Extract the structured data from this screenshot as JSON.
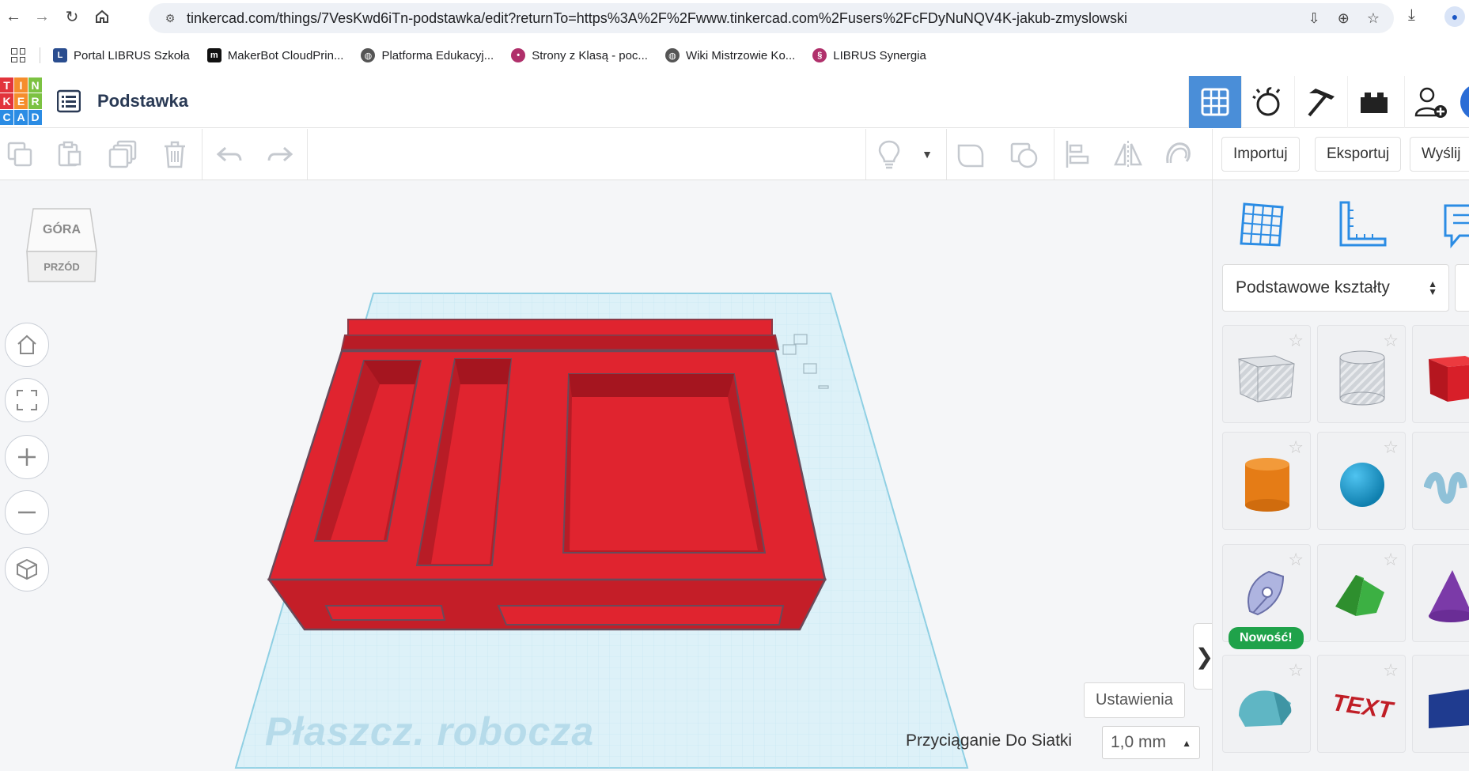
{
  "browser": {
    "url": "tinkercad.com/things/7VesKwd6iTn-podstawka/edit?returnTo=https%3A%2F%2Fwww.tinkercad.com%2Fusers%2FcFDyNuNQV4K-jakub-zmyslowski",
    "bookmarks": [
      {
        "label": "Portal LIBRUS Szkoła",
        "icon": "librus-icon",
        "color": "#2a4d8f"
      },
      {
        "label": "MakerBot CloudPrin...",
        "icon": "makerbot-icon",
        "color": "#111111"
      },
      {
        "label": "Platforma Edukacyj...",
        "icon": "globe-icon",
        "color": "#555555"
      },
      {
        "label": "Strony z Klasą - poc...",
        "icon": "klasa-icon",
        "color": "#b0306b"
      },
      {
        "label": "Wiki Mistrzowie Ko...",
        "icon": "globe-icon",
        "color": "#555555"
      },
      {
        "label": "LIBRUS Synergia",
        "icon": "synergia-icon",
        "color": "#b0306b"
      }
    ]
  },
  "header": {
    "logo_letters": [
      "T",
      "I",
      "N",
      "K",
      "E",
      "R",
      "C",
      "A",
      "D"
    ],
    "logo_colors": [
      "#e2343c",
      "#f58d2c",
      "#7cc242",
      "#e2343c",
      "#f58d2c",
      "#7cc242",
      "#2b8ce4",
      "#2b8ce4",
      "#2b8ce4"
    ],
    "title": "Podstawka",
    "accent": "#4a8ed8"
  },
  "toolbar": {
    "import_label": "Importuj",
    "export_label": "Eksportuj",
    "send_label": "Wyślij"
  },
  "workspace": {
    "view_cube_top": "GÓRA",
    "view_cube_front": "PRZÓD",
    "workplane_label": "Płaszcz. robocza",
    "settings_label": "Ustawienia",
    "snap_label": "Przyciąganie Do Siatki",
    "snap_value": "1,0 mm",
    "model_color": "#e0242f"
  },
  "right_panel": {
    "shape_category": "Podstawowe kształty",
    "new_badge": "Nowość!",
    "shapes": [
      "box-hole",
      "cylinder-hole",
      "box",
      "cylinder",
      "sphere",
      "scribble",
      "sketch",
      "roof",
      "cone",
      "round-roof",
      "text",
      "wedge"
    ]
  }
}
